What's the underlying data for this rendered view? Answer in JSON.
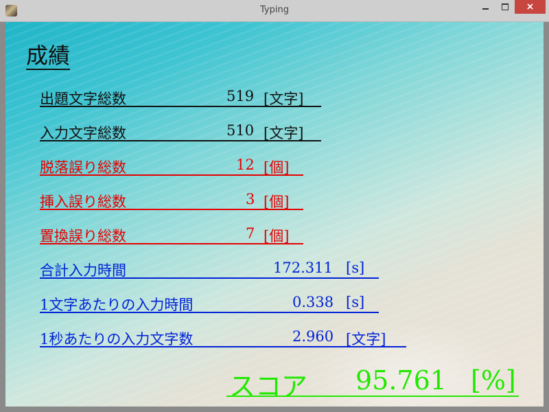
{
  "window": {
    "title": "Typing",
    "close_glyph": "×"
  },
  "heading": "成績",
  "stats": [
    {
      "label": "出題文字総数",
      "value": "519",
      "unit": "[文字]"
    },
    {
      "label": "入力文字総数",
      "value": "510",
      "unit": "[文字]"
    },
    {
      "label": "脱落誤り総数",
      "value": "12",
      "unit": "[個]"
    },
    {
      "label": "挿入誤り総数",
      "value": "3",
      "unit": "[個]"
    },
    {
      "label": "置換誤り総数",
      "value": "7",
      "unit": "[個]"
    },
    {
      "label": "合計入力時間",
      "value": "172.311",
      "unit": "[s]"
    },
    {
      "label": "1文字あたりの入力時間",
      "value": "0.338",
      "unit": "[s]"
    },
    {
      "label": "1秒あたりの入力文字数",
      "value": "2.960",
      "unit": "[文字]"
    }
  ],
  "score": {
    "label": "スコア",
    "value": "95.761",
    "unit": "[%]"
  },
  "colors": {
    "normal": "#111111",
    "error": "#e60000",
    "time": "#0022d8",
    "score": "#22e800"
  }
}
